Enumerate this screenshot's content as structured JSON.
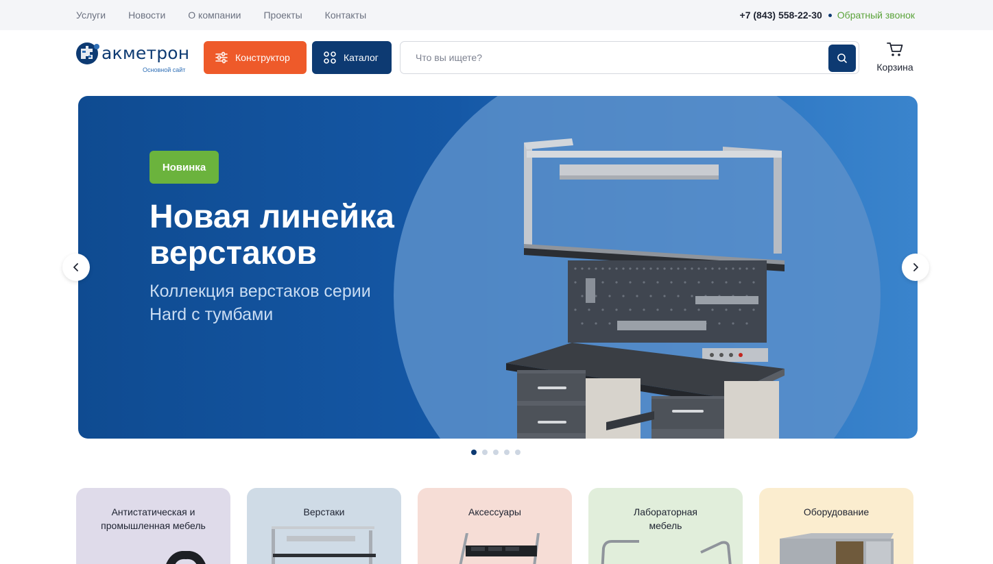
{
  "topbar": {
    "nav": [
      "Услуги",
      "Новости",
      "О компании",
      "Проекты",
      "Контакты"
    ],
    "phone": "+7 (843) 558-22-30",
    "callback": "Обратный звонок"
  },
  "header": {
    "logo_text": "акметрон",
    "logo_sub": "Основной сайт",
    "constructor_label": "Конструктор",
    "catalog_label": "Каталог",
    "search_placeholder": "Что вы ищете?",
    "search_value": "",
    "cart_label": "Корзина"
  },
  "hero": {
    "badge": "Новинка",
    "title": "Новая линейка верстаков",
    "subtitle": "Коллекция верстаков серии Hard с тумбами",
    "slides_total": 5,
    "active_slide": 1
  },
  "categories": [
    {
      "label": "Антистатическая и промышленная мебель",
      "bg": "#dfdbea"
    },
    {
      "label": "Верстаки",
      "bg": "#cfdbe6"
    },
    {
      "label": "Аксессуары",
      "bg": "#f6ddd6"
    },
    {
      "label": "Лабораторная мебель",
      "bg": "#e1eedb"
    },
    {
      "label": "Оборудование",
      "bg": "#fbedcf"
    }
  ],
  "colors": {
    "brand_blue": "#0d3a72",
    "accent_orange": "#ee5a2a",
    "accent_green": "#6bb33d"
  },
  "icons": [
    "sliders-icon",
    "grid-icon",
    "search-icon",
    "cart-icon",
    "chevron-left-icon",
    "chevron-right-icon"
  ]
}
